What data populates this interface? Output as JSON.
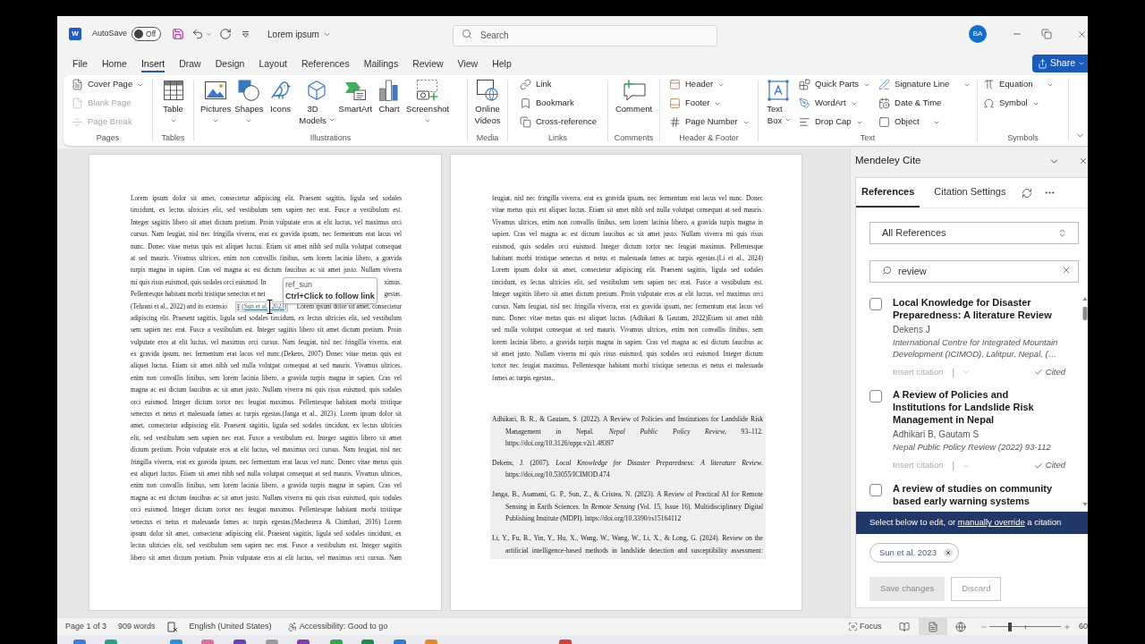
{
  "title_bar": {
    "logo": "W",
    "autosave": {
      "label": "AutoSave",
      "on": false,
      "state_text": "Off"
    },
    "document_title": "Lorem ipsum",
    "search": {
      "placeholder": "Search"
    },
    "avatar": "BA"
  },
  "menu_tabs": [
    {
      "label": "File",
      "selected": false
    },
    {
      "label": "Home",
      "selected": false
    },
    {
      "label": "Insert",
      "selected": true
    },
    {
      "label": "Draw",
      "selected": false
    },
    {
      "label": "Design",
      "selected": false
    },
    {
      "label": "Layout",
      "selected": false
    },
    {
      "label": "References",
      "selected": false
    },
    {
      "label": "Mailings",
      "selected": false
    },
    {
      "label": "Review",
      "selected": false
    },
    {
      "label": "View",
      "selected": false
    },
    {
      "label": "Help",
      "selected": false
    }
  ],
  "share_button": "Share",
  "ribbon": {
    "groups": [
      {
        "label": "Pages",
        "columns": [
          {
            "kind": "stack",
            "items": [
              {
                "label": "Cover Page",
                "kind": "dropdown",
                "disabled": false
              },
              {
                "label": "Blank Page",
                "kind": "button",
                "disabled": true
              },
              {
                "label": "Page Break",
                "kind": "button",
                "disabled": true
              }
            ]
          }
        ]
      },
      {
        "label": "Tables",
        "columns": [
          {
            "kind": "large",
            "items": [
              {
                "label": "Table",
                "kind": "dropdown"
              }
            ]
          }
        ]
      },
      {
        "label": "Illustrations",
        "columns": [
          {
            "kind": "large",
            "items": [
              {
                "label": "Pictures",
                "kind": "dropdown"
              },
              {
                "label": "Shapes",
                "kind": "dropdown"
              },
              {
                "label": "Icons",
                "kind": "button"
              },
              {
                "label": "3D Models",
                "kind": "dropdown"
              },
              {
                "label": "SmartArt",
                "kind": "button"
              },
              {
                "label": "Chart",
                "kind": "button"
              },
              {
                "label": "Screenshot",
                "kind": "dropdown"
              }
            ]
          }
        ]
      },
      {
        "label": "Media",
        "columns": [
          {
            "kind": "large",
            "items": [
              {
                "label": "Online Videos",
                "kind": "button"
              }
            ]
          }
        ]
      },
      {
        "label": "Links",
        "columns": [
          {
            "kind": "stack",
            "items": [
              {
                "label": "Link",
                "kind": "button"
              },
              {
                "label": "Bookmark",
                "kind": "button"
              },
              {
                "label": "Cross-reference",
                "kind": "button"
              }
            ]
          }
        ]
      },
      {
        "label": "Comments",
        "columns": [
          {
            "kind": "large",
            "items": [
              {
                "label": "Comment",
                "kind": "button"
              }
            ]
          }
        ]
      },
      {
        "label": "Header & Footer",
        "columns": [
          {
            "kind": "stack",
            "items": [
              {
                "label": "Header",
                "kind": "dropdown"
              },
              {
                "label": "Footer",
                "kind": "dropdown"
              },
              {
                "label": "Page Number",
                "kind": "dropdown"
              }
            ]
          }
        ]
      },
      {
        "label": "Text",
        "columns": [
          {
            "kind": "large",
            "items": [
              {
                "label": "Text Box",
                "kind": "dropdown"
              }
            ]
          },
          {
            "kind": "stack",
            "items": [
              {
                "label": "Quick Parts",
                "kind": "dropdown"
              },
              {
                "label": "WordArt",
                "kind": "dropdown"
              },
              {
                "label": "Drop Cap",
                "kind": "dropdown"
              }
            ]
          },
          {
            "kind": "stack",
            "items": [
              {
                "label": "Signature Line",
                "kind": "split"
              },
              {
                "label": "Date & Time",
                "kind": "button"
              },
              {
                "label": "Object",
                "kind": "split"
              }
            ]
          }
        ]
      },
      {
        "label": "Symbols",
        "columns": [
          {
            "kind": "stack",
            "items": [
              {
                "label": "Equation",
                "kind": "split"
              },
              {
                "label": "Symbol",
                "kind": "dropdown"
              }
            ]
          }
        ]
      }
    ]
  },
  "document": {
    "left_page": {
      "lines_top": [
        "Lorem ipsum dolor sit amet, consectetur adipiscing elit. Praesent sagittis, ligula sed sodales",
        "tincidunt, ex lectus ultricies elit, sed vestibulum sem sapien nec erat. Fusce a vestibulum est.",
        "Integer sagittis libero sit amet dictum pretium. Proin vulputate eros at elit luctus, vel maximus orci",
        "cursus. Nam feugiat, nisl nec fringilla viverra, erat ex gravida ipsum, nec fermentum erat lacus vel",
        "nunc. Donec vitae metus quis est aliquet luctus. Etiam sit amet nibh sed nulla volutpat consequat",
        "at sed mauris. Vivamus ultrices, enim non convallis finibus, sem lorem lacinia libero, a gravida",
        "turpis magna in sapien. Cras vel magna ac est dictum faucibus ac sit amet justo. Nullam viverra"
      ],
      "covered_lines": [
        {
          "left": "mi quis risus euismod, quis sodales orci euismod. In",
          "right": "ximus."
        },
        {
          "left": "Pellentesque habitant morbi tristique senectus et net",
          "right": "gestas."
        }
      ],
      "citation_line": {
        "before": "(Tehrani et al., 2022) and its extensio",
        "citation": "(Sun et al., 2023)",
        "after": "Lorem ipsum dolor sit amet, consectetur"
      },
      "tooltip": {
        "title": "ref_sun",
        "hint": "Ctrl+Click to follow link"
      },
      "lines_bottom": [
        "adipiscing elit. Praesent sagittis, ligula sed sodales tincidunt, ex lectus ultricies elit, sed vestibulum",
        "sem sapien nec erat. Fusce a vestibulum est. Integer sagittis libero sit amet dictum pretium. Proin",
        "vulputate eros at elit luctus, vel maximus orci cursus. Nam feugiat, nisl nec fringilla viverra, erat",
        "ex gravida ipsum, nec fermentum erat lacus vel nunc.(Dekens, 2007) Donec vitae metus quis est",
        "aliquet luctus. Etiam sit amet nibh sed nulla volutpat consequat at sed mauris. Vivamus ultrices,",
        "enim non convallis finibus, sem lorem lacinia libero, a gravida turpis magna in sapien. Cras vel",
        "magna ac est dictum faucibus ac sit amet justo. Nullam viverra mi quis risus euismod, quis sodales",
        "orci euismod. Integer dictum tortor nec feugiat maximus. Pellentesque habitant morbi tristique",
        "senectus et netus et malesuada fames ac turpis egestas.(Janga et al., 2023). Lorem ipsum dolor sit",
        "amet, consectetur adipiscing elit. Praesent sagittis, ligula sed sodales tincidunt, ex lectus ultricies",
        "elit, sed vestibulum sem sapien nec erat. Fusce a vestibulum est. Integer sagittis libero sit amet",
        "dictum pretium. Proin vulputate eros at elit luctus, vel maximus orci cursus. Nam feugiat, nisl nec",
        "fringilla viverra, erat ex gravida ipsum, nec fermentum erat lacus vel nunc. Donec vitae metus quis",
        "est aliquet luctus. Etiam sit amet nibh sed nulla volutpat consequat at sed mauris. Vivamus ultrices,",
        "enim non convallis finibus, sem lorem lacinia libero, a gravida turpis magna in sapien. Cras vel",
        "magna ac est dictum faucibus ac sit amet justo. Nullam viverra mi quis risus euismod, quis sodales",
        "orci euismod. Integer dictum tortor nec feugiat maximus. Pellentesque habitant morbi tristique",
        "senectus et netus et malesuada fames ac turpis egestas.(Macherera & Chimbari, 2016) Lorem",
        "ipsum dolor sit amet, consectetur adipiscing elit. Praesent sagittis, ligula sed sodales tincidunt, ex",
        "lectus ultricies elit, sed vestibulum sem sapien nec erat. Fusce a vestibulum est. Integer sagittis",
        "libero sit amet dictum pretium. Proin vulputate eros at elit luctus, vel maximus orci cursus. Nam"
      ]
    },
    "right_page": {
      "lines": [
        "feugiat, nisl nec fringilla viverra, erat ex gravida ipsum, nec fermentum erat lacus vel nunc. Donec",
        "vitae metus quis est aliquet luctus. Etiam sit amet nibh sed nulla volutpat consequat at sed mauris.",
        "Vivamus ultrices, enim non convallis finibus, sem lorem lacinia libero, a gravida turpis magna in",
        "sapien. Cras vel magna ac est dictum faucibus ac sit amet justo. Nullam viverra mi quis risus",
        "euismod, quis sodales orci euismod. Integer dictum tortor nec feugiat maximus. Pellentesque",
        "habitant morbi tristique senectus et netus et malesuada fames ac turpis egestas.(Li et al., 2024)",
        "Lorem ipsum dolor sit amet, consectetur adipiscing elit. Praesent sagittis, ligula sed sodales",
        "tincidunt, ex lectus ultricies elit, sed vestibulum sem sapien nec erat. Fusce a vestibulum est.",
        "Integer sagittis libero sit amet dictum pretium. Proin vulputate eros at elit luctus, vel maximus orci",
        "cursus. Nam feugiat, nisl nec fringilla viverra, erat ex gravida ipsum, nec fermentum erat lacus vel",
        "nunc. Donec vitae metus quis est aliquet luctus. (Adhikari & Gautam, 2022)Etiam sit amet nibh",
        "sed nulla volutpat consequat at sed mauris. Vivamus ultrices, enim non convallis finibus, sem",
        "lorem lacinia libero, a gravida turpis magna in sapien. Cras vel magna ac est dictum faucibus ac",
        "sit amet justo. Nullam viverra mi quis risus euismod, quis sodales orci euismod. Integer dictum",
        "tortor nec feugiat maximus. Pellentesque habitant morbi tristique senectus et netus et malesuada",
        "fames ac turpis egestas.."
      ],
      "bibliography": [
        "Adhikari, B. R., & Gautam, S. (2022). A Review of Policies and Institutions for Landslide Risk Management in Nepal. *Nepal Public Policy Review*, 93–112. https://doi.org/10.3126/nppr.v2i1.48397",
        "Dekens, J. (2007). *Local Knowledge for Disaster Preparedness: A literature Review*. https://doi.org/10.53055/ICIMOD.474",
        "Janga, B., Asamani, G. P., Sun, Z., & Cristea, N. (2023). A Review of Practical AI for Remote Sensing in Earth Sciences. In *Remote Sensing* (Vol. 15, Issue 16). Multidisciplinary Digital Publishing Institute (MDPI). https://doi.org/10.3390/rs15164112",
        "Li, Y., Fu, B., Yin, Y., Hu, X., Wang, W., Wang, W., Li, X., & Long, G. (2024). Review on the artificial intelligence-based methods in landslide detection and susceptibility assessment:"
      ]
    }
  },
  "mendeley": {
    "title": "Mendeley Cite",
    "tabs": [
      {
        "label": "References",
        "selected": true
      },
      {
        "label": "Citation Settings",
        "selected": false
      }
    ],
    "library": "All References",
    "search": {
      "value": "review"
    },
    "items": [
      {
        "checked": false,
        "title": "Local Knowledge for Disaster Preparedness: A literature Review",
        "authors": "Dekens J",
        "source": "International Centre for Integrated Mountain Development (ICIMOD), Lalitpur, Nepal, (…",
        "insert_label": "Insert citation",
        "insert_disabled": true,
        "separator": "|",
        "status": "Cited"
      },
      {
        "checked": false,
        "title": "A Review of Policies and Institutions for Landslide Risk Management in Nepal",
        "authors": "Adhikari B, Gautam S",
        "source": "Nepal Public Policy Review (2022) 93-112",
        "insert_label": "Insert citation",
        "insert_disabled": true,
        "separator": "|",
        "status": "Cited"
      },
      {
        "checked": false,
        "title": "A review of studies on community based early warning systems"
      }
    ],
    "banner": {
      "before": "Select below to edit, or ",
      "link": "manually override",
      "after": " a citation"
    },
    "selected_citation": "Sun et al. 2023",
    "buttons": [
      {
        "label": "Save changes",
        "kind": "primary",
        "disabled": true
      },
      {
        "label": "Discard",
        "kind": "secondary",
        "disabled": true
      }
    ]
  },
  "status_bar": {
    "page": "Page 1 of 3",
    "words": "909 words",
    "language": "English (United States)",
    "accessibility": "Accessibility: Good to go",
    "focus": "Focus",
    "views": [
      {
        "kind": "read",
        "selected": false
      },
      {
        "kind": "print",
        "selected": true
      },
      {
        "kind": "web",
        "selected": false
      }
    ],
    "zoom": {
      "level": 0.28,
      "text": "60"
    }
  }
}
